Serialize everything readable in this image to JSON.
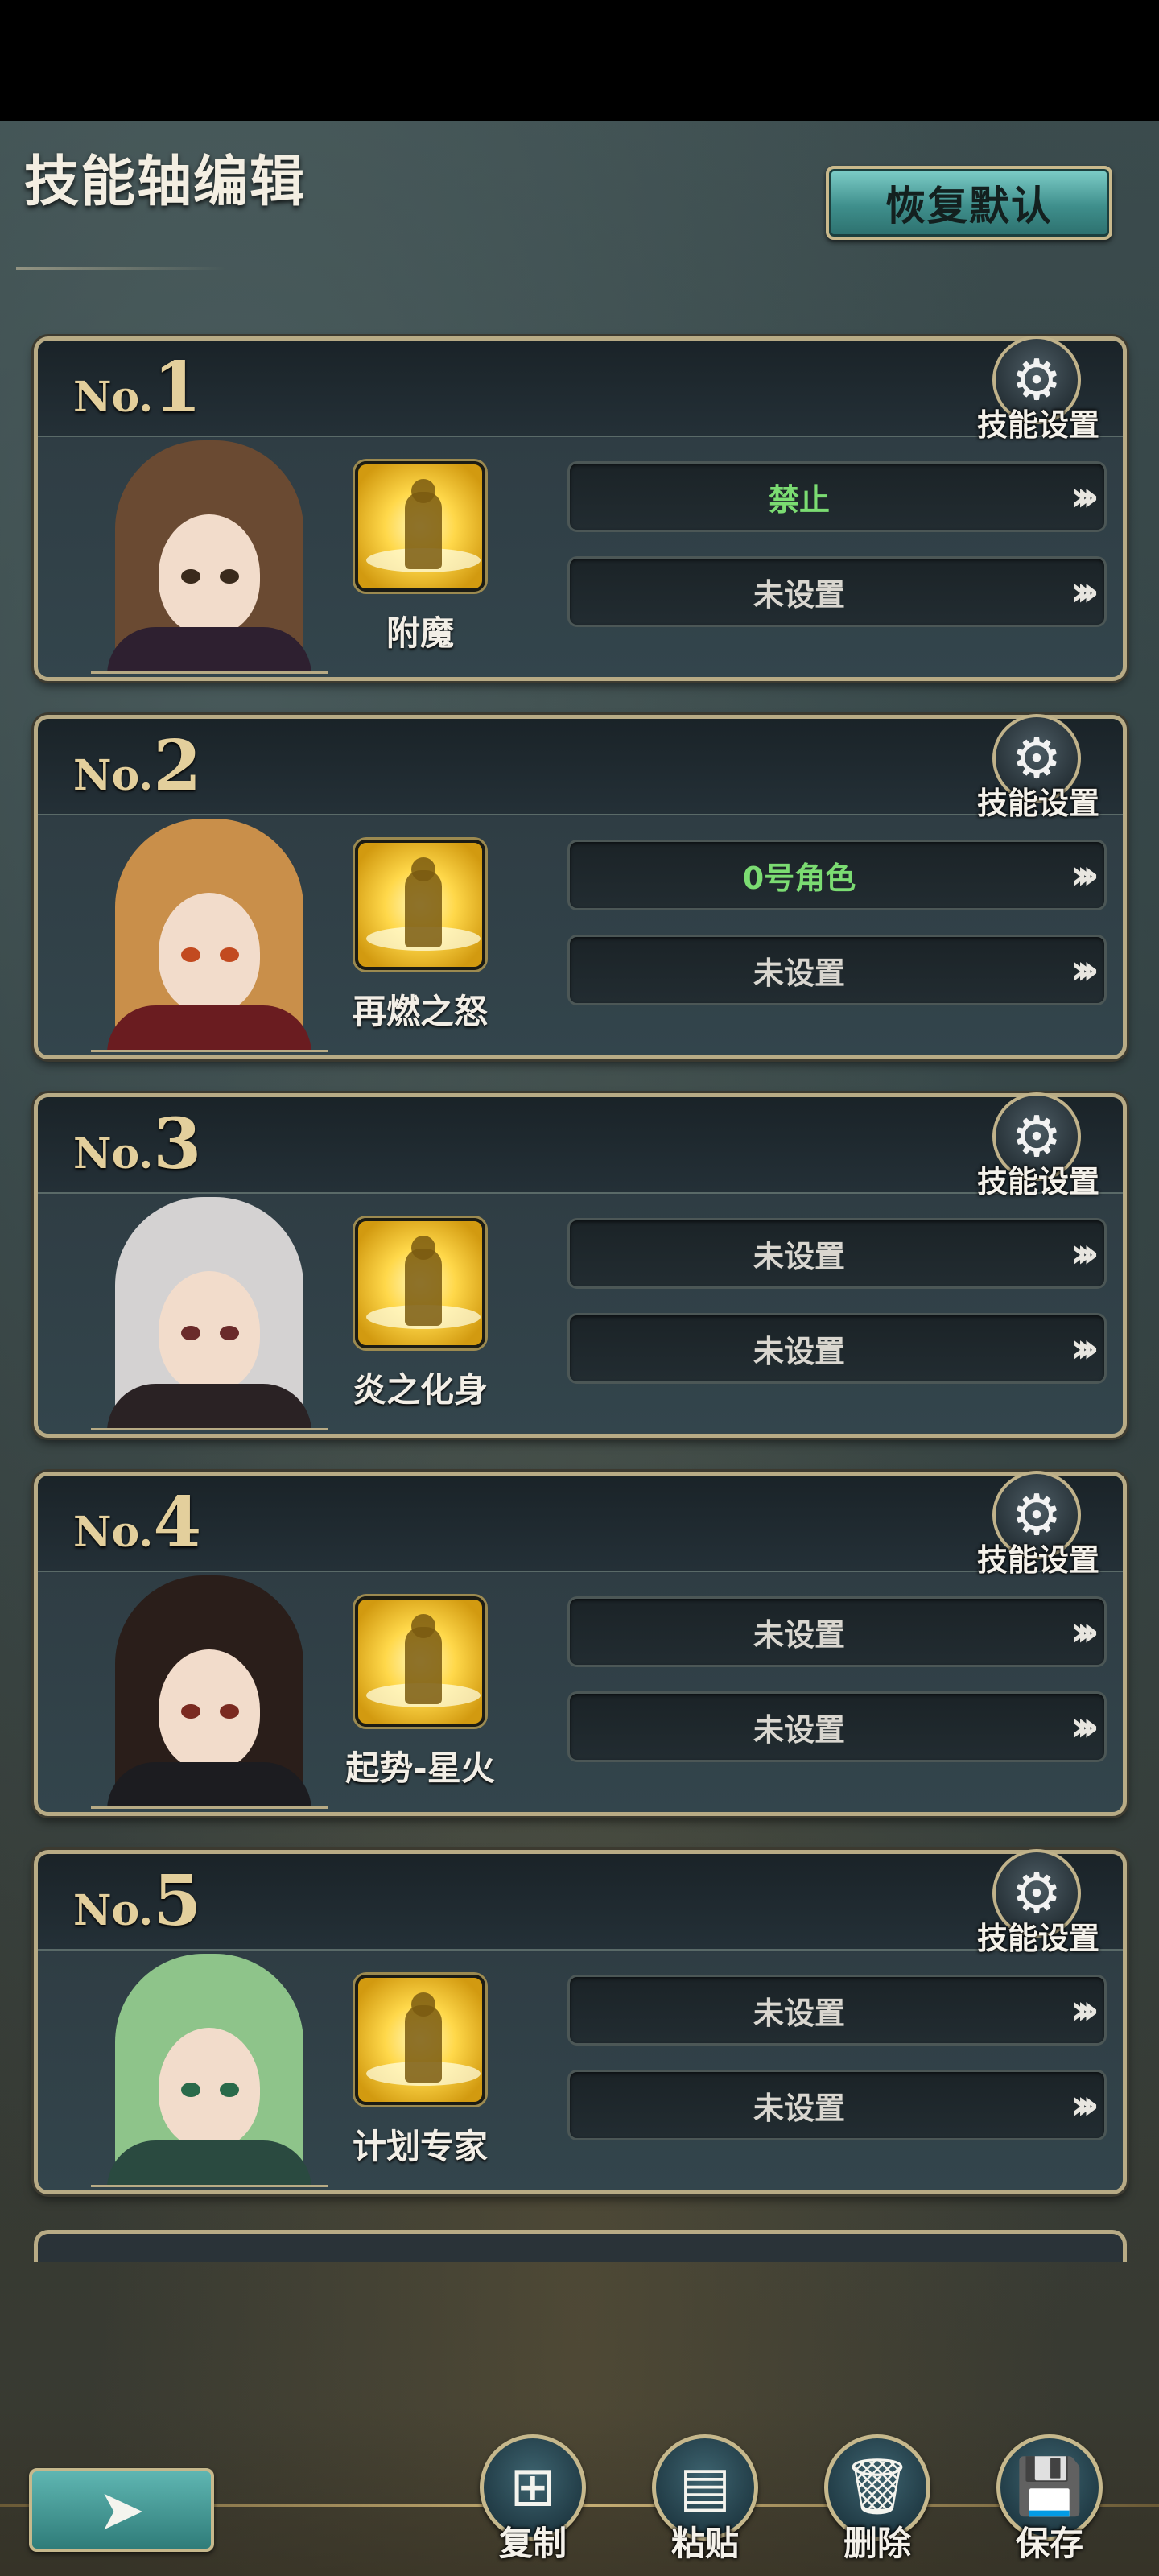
{
  "header": {
    "title": "技能轴编辑",
    "restore_label": "恢复默认"
  },
  "cards": [
    {
      "no_prefix": "No.",
      "no": "1",
      "setting_label": "技能设置",
      "skill_name": "附魔",
      "slot1": "禁止",
      "slot1_green": true,
      "slot2": "未设置",
      "slot2_green": false,
      "hair": "#6a4a32",
      "body": "#2e2030",
      "eye": "#3a2a1c"
    },
    {
      "no_prefix": "No.",
      "no": "2",
      "setting_label": "技能设置",
      "skill_name": "再燃之怒",
      "slot1": "0号角色",
      "slot1_green": true,
      "slot2": "未设置",
      "slot2_green": false,
      "hair": "#c98f4a",
      "body": "#6a1c20",
      "eye": "#c24a20"
    },
    {
      "no_prefix": "No.",
      "no": "3",
      "setting_label": "技能设置",
      "skill_name": "炎之化身",
      "slot1": "未设置",
      "slot1_green": false,
      "slot2": "未设置",
      "slot2_green": false,
      "hair": "#d4d2d2",
      "body": "#2a2224",
      "eye": "#6a2a2a"
    },
    {
      "no_prefix": "No.",
      "no": "4",
      "setting_label": "技能设置",
      "skill_name": "起势-星火",
      "slot1": "未设置",
      "slot1_green": false,
      "slot2": "未设置",
      "slot2_green": false,
      "hair": "#2a1e1a",
      "body": "#1c1c20",
      "eye": "#7a2a20"
    },
    {
      "no_prefix": "No.",
      "no": "5",
      "setting_label": "技能设置",
      "skill_name": "计划专家",
      "slot1": "未设置",
      "slot1_green": false,
      "slot2": "未设置",
      "slot2_green": false,
      "hair": "#8ec48a",
      "body": "#2a4a40",
      "eye": "#2a6a4a"
    }
  ],
  "slot_arrow": "›››",
  "setting_icon": "gear-icon",
  "toolbar": {
    "copy_label": "复制",
    "paste_label": "粘贴",
    "delete_label": "删除",
    "save_label": "保存"
  },
  "colors": {
    "accent_gold": "#c6b88c",
    "status_green": "#7bdc72",
    "teal": "#3f8f8c"
  }
}
